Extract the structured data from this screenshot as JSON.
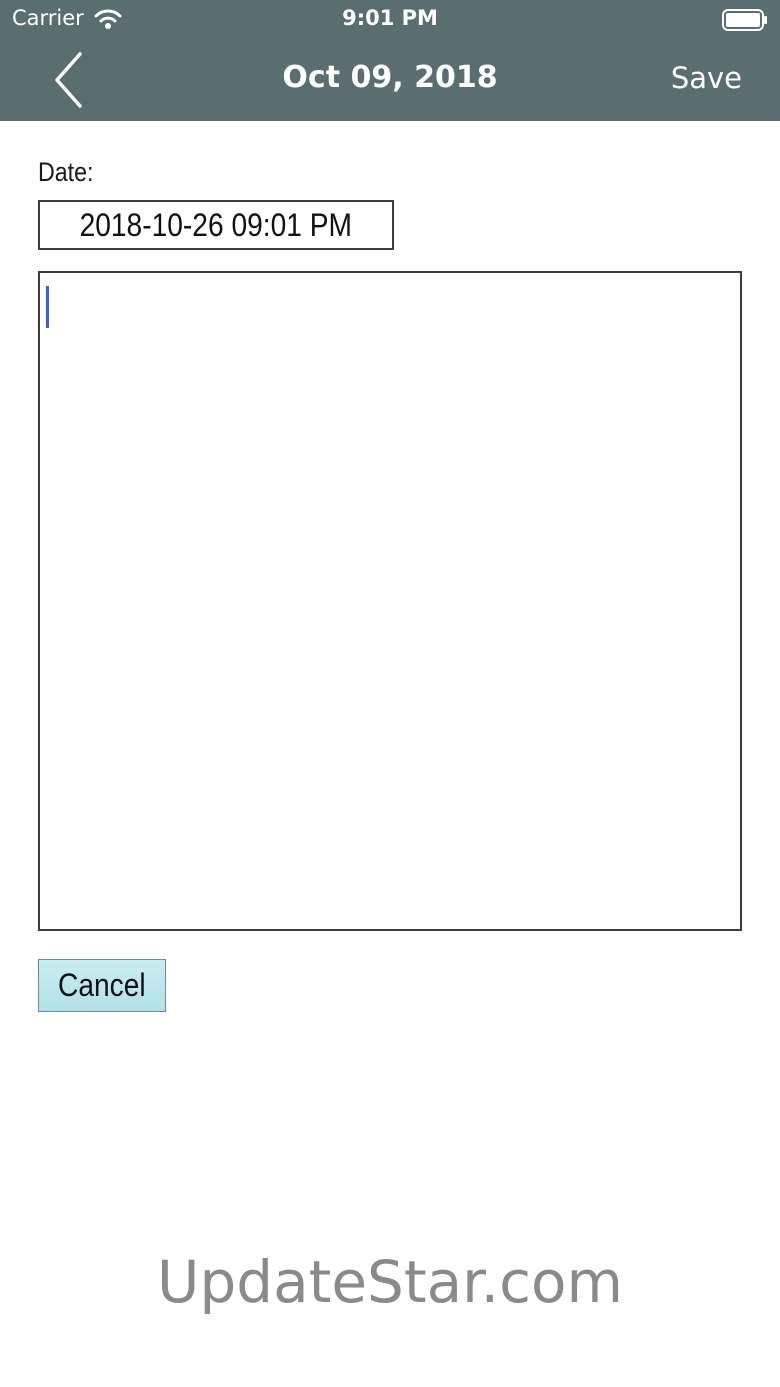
{
  "status_bar": {
    "carrier": "Carrier",
    "time": "9:01 PM"
  },
  "nav": {
    "title": "Oct 09, 2018",
    "save_label": "Save"
  },
  "form": {
    "date_label": "Date:",
    "date_value": "2018-10-26 09:01 PM",
    "note_text": "",
    "cancel_label": "Cancel"
  },
  "watermark": "UpdateStar.com",
  "icons": {
    "wifi": "wifi-icon",
    "battery": "battery-icon",
    "back": "chevron-left-icon"
  },
  "colors": {
    "header_background": "#5a6e72",
    "cancel_button": "#b9e6ec",
    "caret": "#3a64d8"
  }
}
